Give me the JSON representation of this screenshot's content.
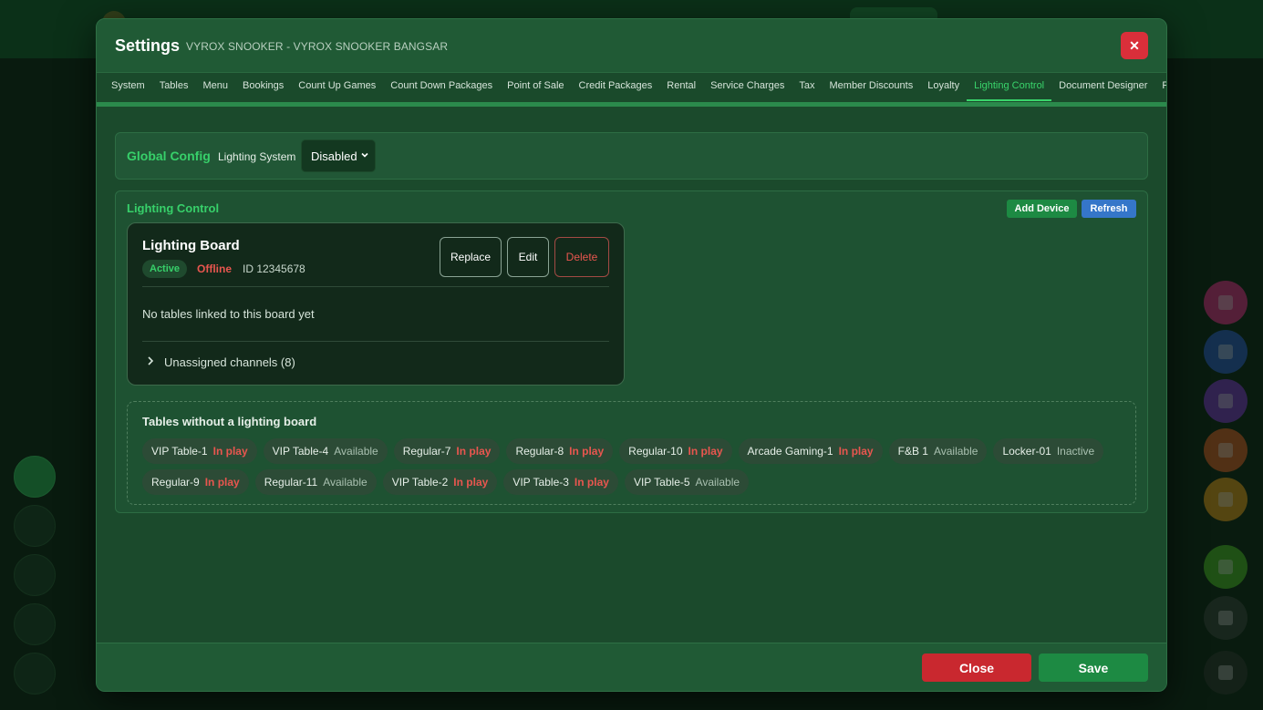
{
  "colors": {
    "accent_green": "#37d06a",
    "danger_red": "#e8564f",
    "close_button": "#c9282f",
    "save_button": "#1d8a43",
    "refresh_button": "#3576c9"
  },
  "modal": {
    "title": "Settings",
    "subtitle": "VYROX SNOOKER - VYROX SNOOKER BANGSAR",
    "close_icon": "close-icon",
    "close_glyph": "✕"
  },
  "tabs": [
    {
      "label": "System"
    },
    {
      "label": "Tables"
    },
    {
      "label": "Menu"
    },
    {
      "label": "Bookings"
    },
    {
      "label": "Count Up Games"
    },
    {
      "label": "Count Down Packages"
    },
    {
      "label": "Point of Sale"
    },
    {
      "label": "Credit Packages"
    },
    {
      "label": "Rental"
    },
    {
      "label": "Service Charges"
    },
    {
      "label": "Tax"
    },
    {
      "label": "Member Discounts"
    },
    {
      "label": "Loyalty"
    },
    {
      "label": "Lighting Control",
      "active": true
    },
    {
      "label": "Document Designer"
    },
    {
      "label": "Printers"
    }
  ],
  "global_config": {
    "heading": "Global Config",
    "lighting_system_label": "Lighting System",
    "lighting_system_value": "Disabled"
  },
  "lighting_control": {
    "heading": "Lighting Control",
    "add_device_label": "Add Device",
    "refresh_label": "Refresh",
    "board": {
      "name": "Lighting Board",
      "active_label": "Active",
      "status_label": "Offline",
      "id_label": "ID 12345678",
      "replace_label": "Replace",
      "edit_label": "Edit",
      "delete_label": "Delete",
      "no_tables_text": "No tables linked to this board yet",
      "unassigned_label": "Unassigned channels (8)"
    },
    "unlinked": {
      "heading": "Tables without a lighting board",
      "tables": [
        {
          "name": "VIP Table-1",
          "status": "In play"
        },
        {
          "name": "VIP Table-4",
          "status": "Available"
        },
        {
          "name": "Regular-7",
          "status": "In play"
        },
        {
          "name": "Regular-8",
          "status": "In play"
        },
        {
          "name": "Regular-10",
          "status": "In play"
        },
        {
          "name": "Arcade Gaming-1",
          "status": "In play"
        },
        {
          "name": "F&B 1",
          "status": "Available"
        },
        {
          "name": "Locker-01",
          "status": "Inactive"
        },
        {
          "name": "Regular-9",
          "status": "In play"
        },
        {
          "name": "Regular-11",
          "status": "Available"
        },
        {
          "name": "VIP Table-2",
          "status": "In play"
        },
        {
          "name": "VIP Table-3",
          "status": "In play"
        },
        {
          "name": "VIP Table-5",
          "status": "Available"
        }
      ]
    }
  },
  "footer": {
    "close_label": "Close",
    "save_label": "Save"
  }
}
